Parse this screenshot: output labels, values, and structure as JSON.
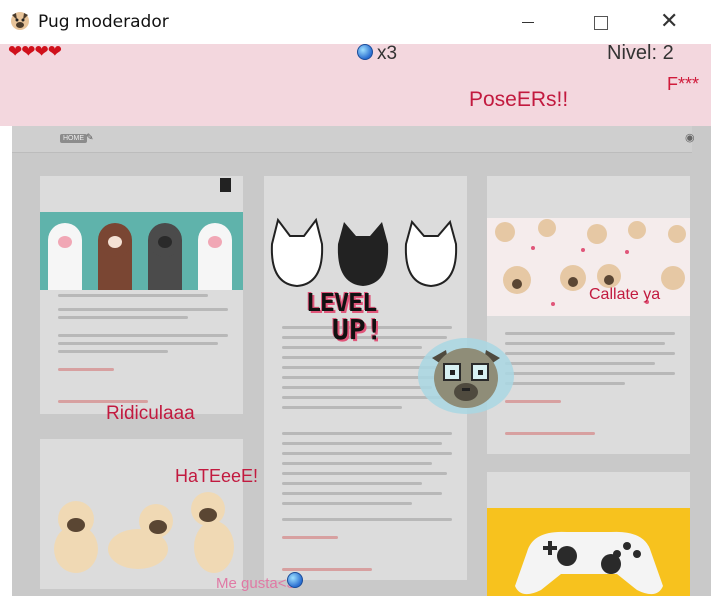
{
  "window": {
    "title": "Pug moderador"
  },
  "hud": {
    "orb_count": "x3",
    "level_label": "Nivel: 2",
    "lives": 4
  },
  "floating_words": [
    {
      "text": "F***",
      "color": "#d01b3b"
    },
    {
      "text": "PoseERs!!",
      "color": "#c21a3f"
    },
    {
      "text": "Callate ya",
      "color": "#c21a3f"
    },
    {
      "text": "Ridiculaaa",
      "color": "#c21a3f"
    },
    {
      "text": "HaTEeeE!",
      "color": "#c21a3f"
    },
    {
      "text": "Me gusta<3",
      "color": "#e07aa5"
    }
  ],
  "level_up": [
    "LEVEL",
    "UP!"
  ],
  "blog": {
    "home_label": "HOME"
  }
}
